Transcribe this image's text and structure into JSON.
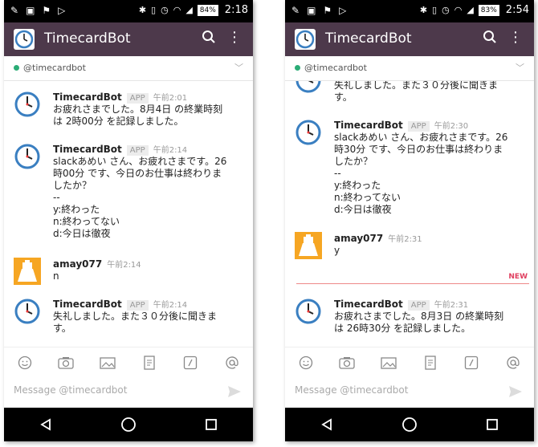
{
  "left": {
    "status": {
      "time": "2:18",
      "battery": "84%"
    },
    "app": {
      "title": "TimecardBot"
    },
    "channel": {
      "name": "@timecardbot"
    },
    "messages": [
      {
        "user": "TimecardBot",
        "badge": "APP",
        "time": "午前2:01",
        "lines": [
          "お疲れさまでした。8月4日 の終業時刻",
          "は 2時00分 を記録しました。"
        ]
      },
      {
        "user": "TimecardBot",
        "badge": "APP",
        "time": "午前2:14",
        "lines": [
          "slackあめい さん、お疲れさまです。26",
          "時00分 です、今日のお仕事は終わりま",
          "したか？",
          "--",
          "y:終わった",
          "n:終わってない",
          "d:今日は徹夜"
        ]
      },
      {
        "user": "amay077",
        "time": "午前2:14",
        "lines": [
          "n"
        ]
      },
      {
        "user": "TimecardBot",
        "badge": "APP",
        "time": "午前2:14",
        "lines": [
          "失礼しました。また３０分後に聞きま",
          "す。"
        ]
      }
    ],
    "composer": {
      "placeholder": "Message @timecardbot"
    }
  },
  "right": {
    "status": {
      "time": "2:54",
      "battery": "83%"
    },
    "app": {
      "title": "TimecardBot"
    },
    "channel": {
      "name": "@timecardbot"
    },
    "messages": [
      {
        "lines": [
          "失礼しました。また３０分後に聞きま",
          "す。"
        ]
      },
      {
        "user": "TimecardBot",
        "badge": "APP",
        "time": "午前2:30",
        "lines": [
          "slackあめい さん、お疲れさまです。26",
          "時30分 です、今日のお仕事は終わりま",
          "したか？",
          "--",
          "y:終わった",
          "n:終わってない",
          "d:今日は徹夜"
        ]
      },
      {
        "user": "amay077",
        "time": "午前2:31",
        "lines": [
          "y"
        ]
      },
      {
        "user": "TimecardBot",
        "badge": "APP",
        "time": "午前2:31",
        "lines": [
          "お疲れさまでした。8月3日 の終業時刻",
          "は 26時30分 を記録しました。"
        ]
      }
    ],
    "new_label": "NEW",
    "composer": {
      "placeholder": "Message @timecardbot"
    }
  },
  "colors": {
    "appbar": "#4d394b",
    "presence": "#2bac76",
    "new": "#e04060"
  },
  "icons": [
    "clock-avatar-icon",
    "bot-avatar-icon",
    "search-icon",
    "more-icon",
    "emoji-icon",
    "camera-icon",
    "image-icon",
    "file-icon",
    "slash-icon",
    "mention-icon",
    "send-icon",
    "back-icon",
    "home-icon",
    "recents-icon"
  ]
}
